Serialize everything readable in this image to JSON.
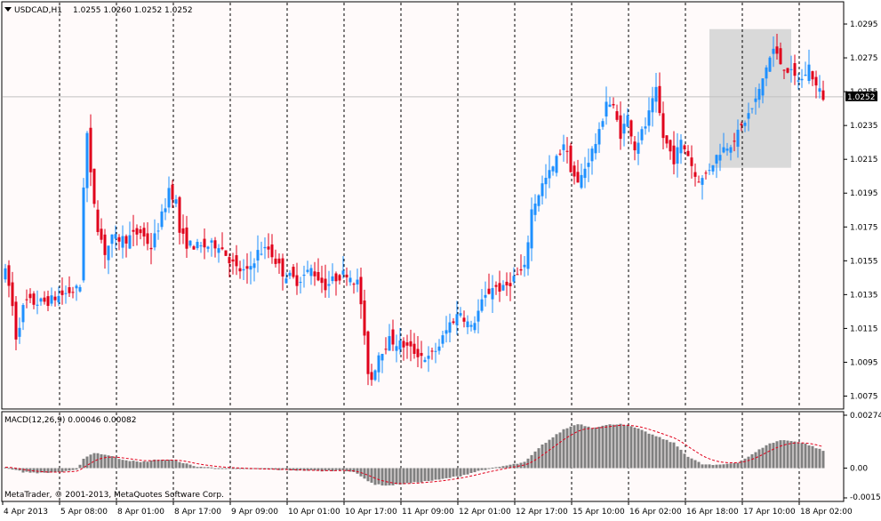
{
  "chart_window": {
    "symbol_label": "USDCAD,H1",
    "ohlc_label": "1.0255 1.0260 1.0252 1.0252",
    "indicator_label": "MACD(12,26,9) 0.00046 0.00082",
    "copyright": "MetaTrader, © 2001-2013, MetaQuotes Software Corp."
  },
  "colors": {
    "background": "#fffafa",
    "bull": "#1e90ff",
    "bear": "#e0001b",
    "macd_hist": "#808080",
    "signal_line": "#e0001b",
    "highlight": "#d9d9d9",
    "grid": "#000000"
  },
  "chart_data": [
    {
      "type": "candlestick",
      "symbol": "USDCAD",
      "timeframe": "H1",
      "ylim": [
        1.007,
        1.0305
      ],
      "y_ticks": [
        "1.0295",
        "1.0275",
        "1.0255",
        "1.0235",
        "1.0215",
        "1.0195",
        "1.0175",
        "1.0155",
        "1.0135",
        "1.0115",
        "1.0095",
        "1.0075"
      ],
      "current_price": "1.0252",
      "x_ticks": [
        "4 Apr 2013",
        "5 Apr 08:00",
        "8 Apr 01:00",
        "8 Apr 17:00",
        "9 Apr 09:00",
        "10 Apr 01:00",
        "10 Apr 17:00",
        "11 Apr 09:00",
        "12 Apr 01:00",
        "12 Apr 17:00",
        "15 Apr 10:00",
        "16 Apr 02:00",
        "16 Apr 18:00",
        "17 Apr 10:00",
        "18 Apr 02:00"
      ],
      "anchor_closes": [
        [
          0,
          1.0148
        ],
        [
          1,
          1.014
        ],
        [
          2,
          1.0128
        ],
        [
          3,
          1.011
        ],
        [
          4,
          1.0118
        ],
        [
          5,
          1.0127
        ],
        [
          6,
          1.0131
        ],
        [
          8,
          1.013
        ],
        [
          12,
          1.0131
        ],
        [
          16,
          1.0135
        ],
        [
          20,
          1.0138
        ],
        [
          21,
          1.014
        ],
        [
          22,
          1.02
        ],
        [
          23,
          1.023
        ],
        [
          24,
          1.0205
        ],
        [
          25,
          1.019
        ],
        [
          26,
          1.0175
        ],
        [
          28,
          1.016
        ],
        [
          30,
          1.0168
        ],
        [
          34,
          1.0168
        ],
        [
          38,
          1.0172
        ],
        [
          41,
          1.0163
        ],
        [
          43,
          1.0175
        ],
        [
          45,
          1.0188
        ],
        [
          46,
          1.0198
        ],
        [
          48,
          1.019
        ],
        [
          49,
          1.0172
        ],
        [
          51,
          1.0165
        ],
        [
          55,
          1.0163
        ],
        [
          60,
          1.0165
        ],
        [
          65,
          1.015
        ],
        [
          68,
          1.0148
        ],
        [
          71,
          1.016
        ],
        [
          74,
          1.0162
        ],
        [
          78,
          1.0148
        ],
        [
          82,
          1.0143
        ],
        [
          86,
          1.015
        ],
        [
          90,
          1.014
        ],
        [
          93,
          1.0145
        ],
        [
          96,
          1.0148
        ],
        [
          99,
          1.0142
        ],
        [
          100,
          1.013
        ],
        [
          101,
          1.0108
        ],
        [
          102,
          1.009
        ],
        [
          103,
          1.0085
        ],
        [
          105,
          1.01
        ],
        [
          108,
          1.0108
        ],
        [
          112,
          1.0105
        ],
        [
          116,
          1.01
        ],
        [
          119,
          1.0097
        ],
        [
          122,
          1.0105
        ],
        [
          125,
          1.0118
        ],
        [
          128,
          1.0125
        ],
        [
          131,
          1.0115
        ],
        [
          134,
          1.013
        ],
        [
          137,
          1.014
        ],
        [
          140,
          1.0138
        ],
        [
          143,
          1.0145
        ],
        [
          146,
          1.015
        ],
        [
          148,
          1.0185
        ],
        [
          151,
          1.02
        ],
        [
          154,
          1.021
        ],
        [
          157,
          1.0225
        ],
        [
          159,
          1.021
        ],
        [
          161,
          1.02
        ],
        [
          164,
          1.0215
        ],
        [
          167,
          1.023
        ],
        [
          169,
          1.025
        ],
        [
          171,
          1.0245
        ],
        [
          173,
          1.023
        ],
        [
          175,
          1.024
        ],
        [
          177,
          1.0222
        ],
        [
          180,
          1.0235
        ],
        [
          183,
          1.0255
        ],
        [
          185,
          1.0228
        ],
        [
          188,
          1.0215
        ],
        [
          190,
          1.0225
        ],
        [
          192,
          1.0218
        ],
        [
          194,
          1.0205
        ],
        [
          196,
          1.0203
        ],
        [
          198,
          1.021
        ],
        [
          201,
          1.022
        ],
        [
          204,
          1.0225
        ],
        [
          206,
          1.023
        ],
        [
          208,
          1.0238
        ],
        [
          210,
          1.0245
        ],
        [
          212,
          1.0255
        ],
        [
          214,
          1.027
        ],
        [
          216,
          1.028
        ],
        [
          218,
          1.0272
        ],
        [
          220,
          1.0268
        ],
        [
          222,
          1.0263
        ],
        [
          224,
          1.0262
        ],
        [
          226,
          1.027
        ],
        [
          228,
          1.0258
        ],
        [
          230,
          1.0252
        ]
      ],
      "macd": {
        "ylim": [
          -0.00154,
          0.00274
        ],
        "y_ticks": [
          "0.00274",
          "0.00",
          "-0.00154"
        ],
        "anchor_hist": [
          [
            0,
            5e-05
          ],
          [
            5,
            -0.0002
          ],
          [
            10,
            -0.00025
          ],
          [
            16,
            -0.0002
          ],
          [
            20,
            -0.0001
          ],
          [
            22,
            0.0005
          ],
          [
            25,
            0.0008
          ],
          [
            28,
            0.0007
          ],
          [
            33,
            0.00045
          ],
          [
            38,
            0.0003
          ],
          [
            43,
            0.00045
          ],
          [
            48,
            0.0004
          ],
          [
            53,
            0.0001
          ],
          [
            60,
            0.0
          ],
          [
            70,
            -5e-05
          ],
          [
            80,
            -0.0001
          ],
          [
            90,
            -0.00015
          ],
          [
            95,
            -0.0001
          ],
          [
            98,
            -0.0002
          ],
          [
            101,
            -0.00055
          ],
          [
            104,
            -0.00085
          ],
          [
            108,
            -0.0009
          ],
          [
            115,
            -0.00075
          ],
          [
            122,
            -0.0006
          ],
          [
            128,
            -0.0004
          ],
          [
            134,
            -0.0001
          ],
          [
            140,
            0.0001
          ],
          [
            146,
            0.0003
          ],
          [
            151,
            0.0012
          ],
          [
            157,
            0.002
          ],
          [
            161,
            0.0023
          ],
          [
            165,
            0.0021
          ],
          [
            170,
            0.00225
          ],
          [
            173,
            0.0023
          ],
          [
            177,
            0.0021
          ],
          [
            183,
            0.00165
          ],
          [
            188,
            0.0013
          ],
          [
            192,
            0.0006
          ],
          [
            196,
            0.0002
          ],
          [
            200,
            0.00015
          ],
          [
            206,
            0.0003
          ],
          [
            210,
            0.0007
          ],
          [
            214,
            0.0012
          ],
          [
            218,
            0.00145
          ],
          [
            222,
            0.0014
          ],
          [
            226,
            0.0012
          ],
          [
            230,
            0.0009
          ]
        ]
      },
      "highlight_box": {
        "from_index": 198,
        "to_index": 221,
        "price_top": 1.0292,
        "price_bottom": 1.021
      }
    }
  ]
}
